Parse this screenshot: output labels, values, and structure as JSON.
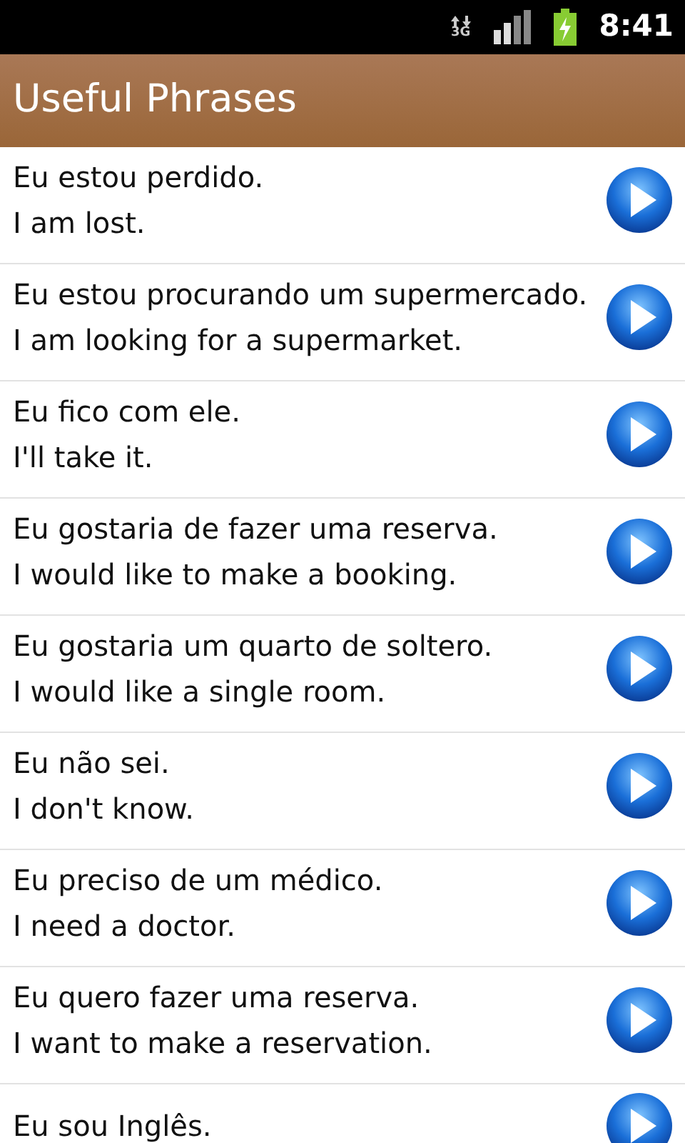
{
  "status_bar": {
    "network": "3G",
    "time": "8:41"
  },
  "title_bar": {
    "title": "Useful Phrases"
  },
  "phrases": [
    {
      "portuguese": "Eu estou perdido.",
      "english": "I am lost."
    },
    {
      "portuguese": "Eu estou procurando um supermercado.",
      "english": "I am looking for a supermarket."
    },
    {
      "portuguese": "Eu fico com ele.",
      "english": "I'll take it."
    },
    {
      "portuguese": "Eu gostaria de fazer uma reserva.",
      "english": "I would like to make a booking."
    },
    {
      "portuguese": "Eu gostaria um quarto de soltero.",
      "english": "I would like a single room."
    },
    {
      "portuguese": "Eu não sei.",
      "english": "I don't know."
    },
    {
      "portuguese": "Eu preciso de um médico.",
      "english": "I need a doctor."
    },
    {
      "portuguese": "Eu quero fazer uma reserva.",
      "english": "I want to make a reservation."
    },
    {
      "portuguese": "Eu sou Inglês."
    }
  ]
}
